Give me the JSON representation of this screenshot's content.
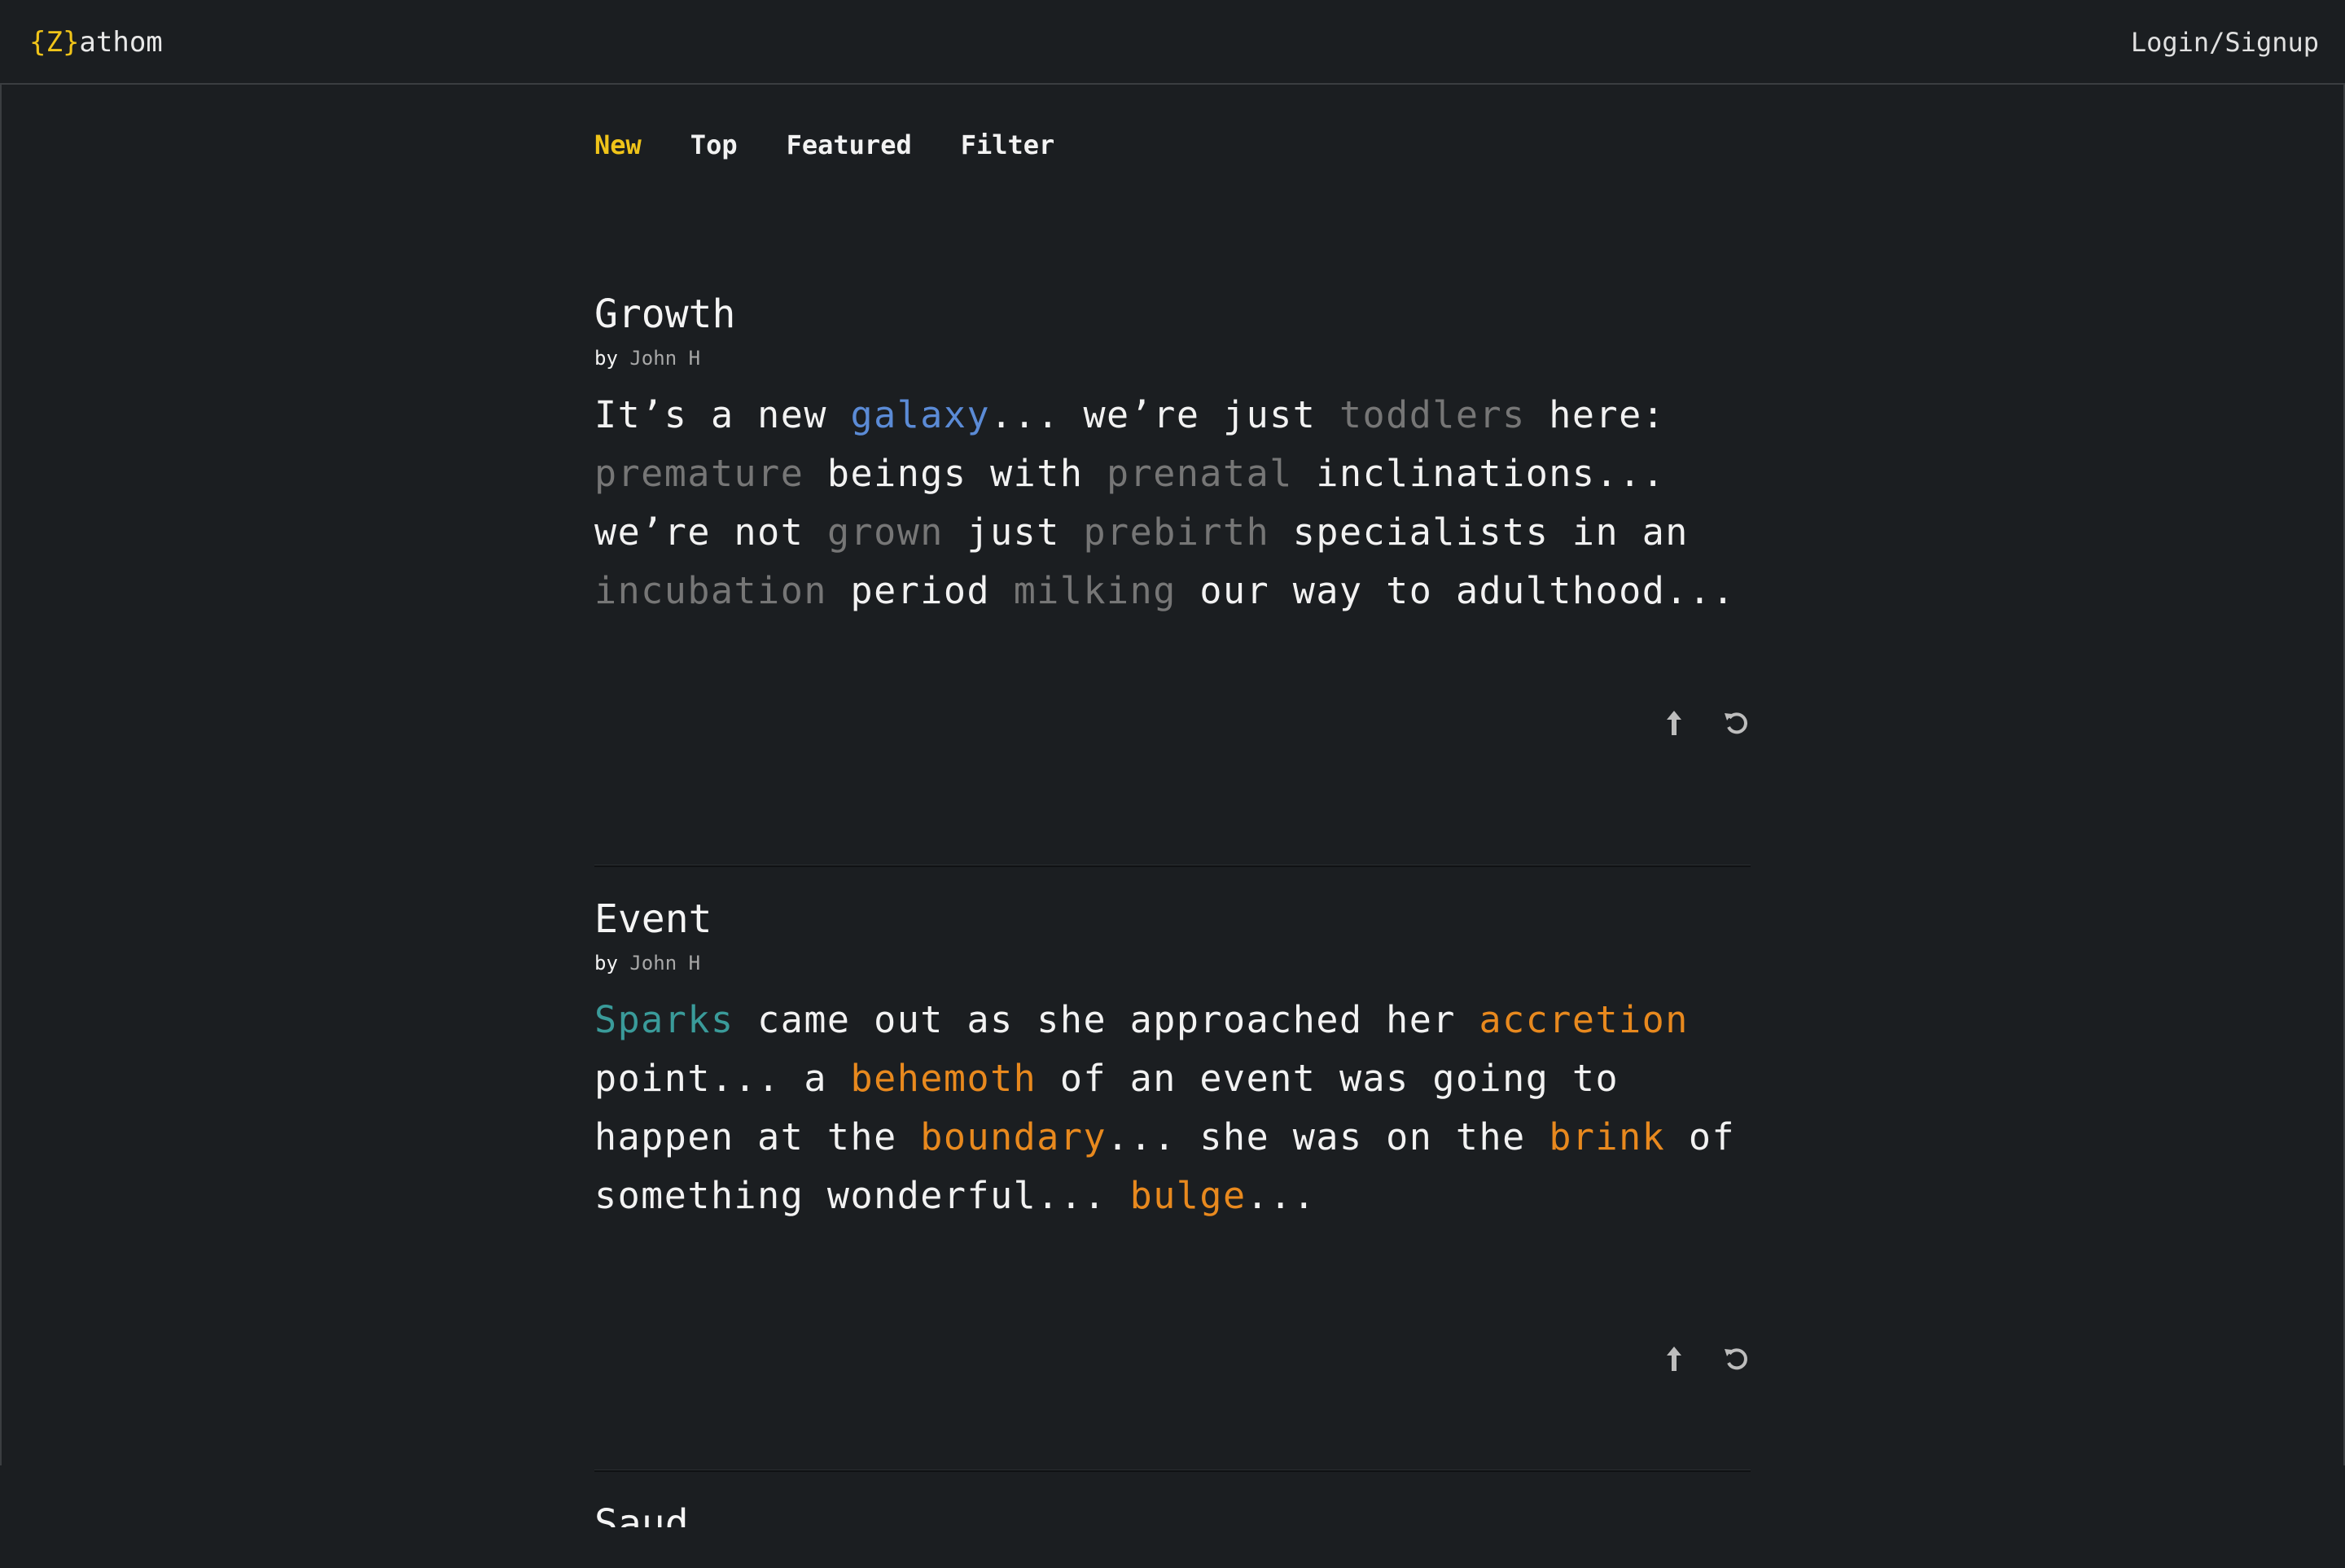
{
  "app": {
    "logo_open": "{Z}",
    "logo_rest": "athom",
    "login_label": "Login/Signup"
  },
  "tabs": [
    {
      "label": "New",
      "active": true
    },
    {
      "label": "Top",
      "active": false
    },
    {
      "label": "Featured",
      "active": false
    },
    {
      "label": "Filter",
      "active": false
    }
  ],
  "colors": {
    "accent": "#f0c419",
    "background": "#1b1e21",
    "gray_word": "#767676",
    "blue_word": "#5b8bd6",
    "teal_word": "#3a9b9a",
    "orange_word": "#e8891e"
  },
  "posts": [
    {
      "title": "Growth",
      "by": "by",
      "author": "John H",
      "segments": [
        {
          "t": "It’s a new ",
          "c": ""
        },
        {
          "t": "galaxy",
          "c": "blue"
        },
        {
          "t": "... we’re just ",
          "c": ""
        },
        {
          "t": "toddlers",
          "c": "gray"
        },
        {
          "t": " here: ",
          "c": ""
        },
        {
          "t": "premature",
          "c": "gray"
        },
        {
          "t": " beings with ",
          "c": ""
        },
        {
          "t": "prenatal",
          "c": "gray"
        },
        {
          "t": " inclinations... we’re not ",
          "c": ""
        },
        {
          "t": "grown",
          "c": "gray"
        },
        {
          "t": " just ",
          "c": ""
        },
        {
          "t": "prebirth",
          "c": "gray"
        },
        {
          "t": " specialists in an ",
          "c": ""
        },
        {
          "t": "incubation",
          "c": "gray"
        },
        {
          "t": " period ",
          "c": ""
        },
        {
          "t": "milking",
          "c": "gray"
        },
        {
          "t": " our way to adulthood...",
          "c": ""
        }
      ],
      "actions": [
        "upvote-icon",
        "refresh-icon"
      ]
    },
    {
      "title": "Event",
      "by": "by",
      "author": "John H",
      "segments": [
        {
          "t": "Sparks",
          "c": "teal"
        },
        {
          "t": " came out as she approached her ",
          "c": ""
        },
        {
          "t": "accretion",
          "c": "orange"
        },
        {
          "t": "  point... a ",
          "c": ""
        },
        {
          "t": "behemoth",
          "c": "orange"
        },
        {
          "t": " of an event was going to happen at the ",
          "c": ""
        },
        {
          "t": "boundary",
          "c": "orange"
        },
        {
          "t": "... she was on the ",
          "c": ""
        },
        {
          "t": "brink",
          "c": "orange"
        },
        {
          "t": " of something wonderful... ",
          "c": ""
        },
        {
          "t": "bulge",
          "c": "orange"
        },
        {
          "t": "...",
          "c": ""
        }
      ],
      "actions": [
        "upvote-icon",
        "refresh-icon"
      ]
    }
  ],
  "next_post_title_partial": "Saud"
}
